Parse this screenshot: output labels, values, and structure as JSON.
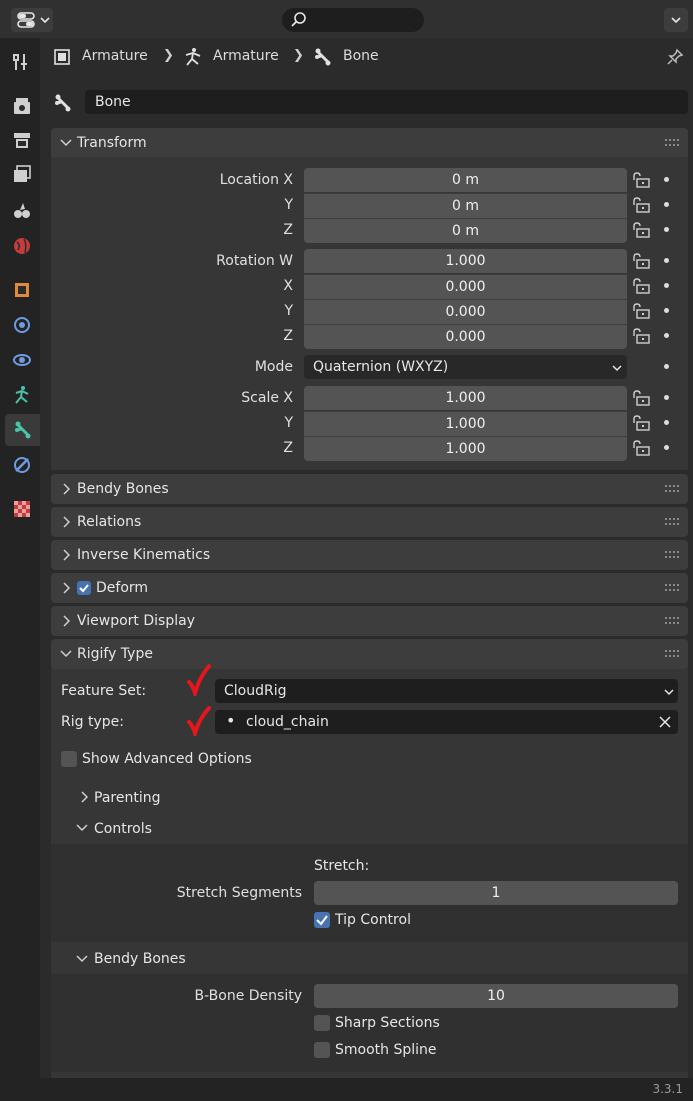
{
  "breadcrumb": [
    {
      "label": "Armature",
      "icon": "armature-object-icon"
    },
    {
      "label": "Armature",
      "icon": "armature-data-icon"
    },
    {
      "label": "Bone",
      "icon": "bone-icon"
    }
  ],
  "bone_name": "Bone",
  "sections": {
    "transform": "Transform",
    "bendy_bones": "Bendy Bones",
    "relations": "Relations",
    "inverse_kinematics": "Inverse Kinematics",
    "deform": "Deform",
    "viewport_display": "Viewport Display",
    "rigify_type": "Rigify Type"
  },
  "transform": {
    "location": [
      {
        "label": "Location X",
        "value": "0 m"
      },
      {
        "label": "Y",
        "value": "0 m"
      },
      {
        "label": "Z",
        "value": "0 m"
      }
    ],
    "rotation": [
      {
        "label": "Rotation W",
        "value": "1.000"
      },
      {
        "label": "X",
        "value": "0.000"
      },
      {
        "label": "Y",
        "value": "0.000"
      },
      {
        "label": "Z",
        "value": "0.000"
      }
    ],
    "mode_label": "Mode",
    "mode_value": "Quaternion (WXYZ)",
    "scale": [
      {
        "label": "Scale X",
        "value": "1.000"
      },
      {
        "label": "Y",
        "value": "1.000"
      },
      {
        "label": "Z",
        "value": "1.000"
      }
    ]
  },
  "rigify": {
    "feature_set_label": "Feature Set:",
    "feature_set_value": "CloudRig",
    "rig_type_label": "Rig type:",
    "rig_type_value": "cloud_chain",
    "show_advanced": "Show Advanced Options",
    "parenting": "Parenting",
    "controls": "Controls",
    "stretch_header": "Stretch:",
    "stretch_segments_label": "Stretch Segments",
    "stretch_segments_value": "1",
    "tip_control": "Tip Control",
    "bendy_bones": "Bendy Bones",
    "bbone_density_label": "B-Bone Density",
    "bbone_density_value": "10",
    "sharp_sections": "Sharp Sections",
    "smooth_spline": "Smooth Spline"
  },
  "version": "3.3.1",
  "colors": {
    "accent": "#4772b3",
    "annotation": "#e8151b",
    "active_tab_icon": "#4bc3a9"
  }
}
